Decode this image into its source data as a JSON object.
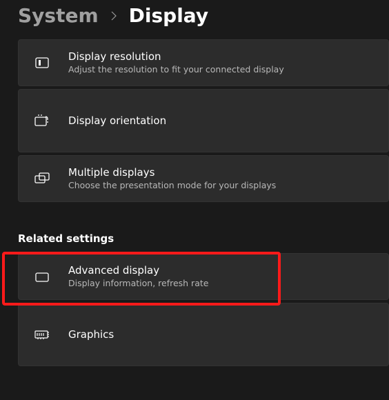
{
  "breadcrumb": {
    "parent": "System",
    "current": "Display"
  },
  "main_items": [
    {
      "icon": "resolution-icon",
      "title": "Display resolution",
      "subtitle": "Adjust the resolution to fit your connected display"
    },
    {
      "icon": "orientation-icon",
      "title": "Display orientation",
      "subtitle": ""
    },
    {
      "icon": "multiple-displays-icon",
      "title": "Multiple displays",
      "subtitle": "Choose the presentation mode for your displays"
    }
  ],
  "related_header": "Related settings",
  "related_items": [
    {
      "icon": "advanced-display-icon",
      "title": "Advanced display",
      "subtitle": "Display information, refresh rate",
      "highlighted": true
    },
    {
      "icon": "graphics-icon",
      "title": "Graphics",
      "subtitle": ""
    }
  ]
}
